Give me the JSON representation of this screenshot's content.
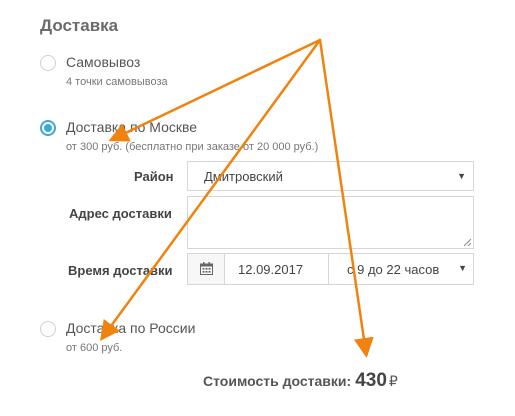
{
  "section": {
    "title": "Доставка"
  },
  "options": [
    {
      "label": "Самовывоз",
      "sub": "4 точки самовывоза",
      "checked": false
    },
    {
      "label": "Доставка по Москве",
      "sub": "от 300 руб. (бесплатно при заказе от 20 000 руб.)",
      "checked": true
    },
    {
      "label": "Доставка по России",
      "sub": "от 600 руб.",
      "checked": false
    }
  ],
  "form": {
    "district_label": "Район",
    "district_value": "Дмитровский",
    "address_label": "Адрес доставки",
    "address_value": "",
    "time_label": "Время доставки",
    "date_value": "12.09.2017",
    "time_value": "с 9 до 22 часов"
  },
  "cost": {
    "label": "Стоимость доставки:",
    "value": "430",
    "currency": "₽"
  },
  "colors": {
    "accent": "#3fa7d6",
    "annotation": "#f0830f"
  },
  "icons": {
    "calendar": "calendar-icon",
    "dropdown": "chevron-down-icon"
  }
}
